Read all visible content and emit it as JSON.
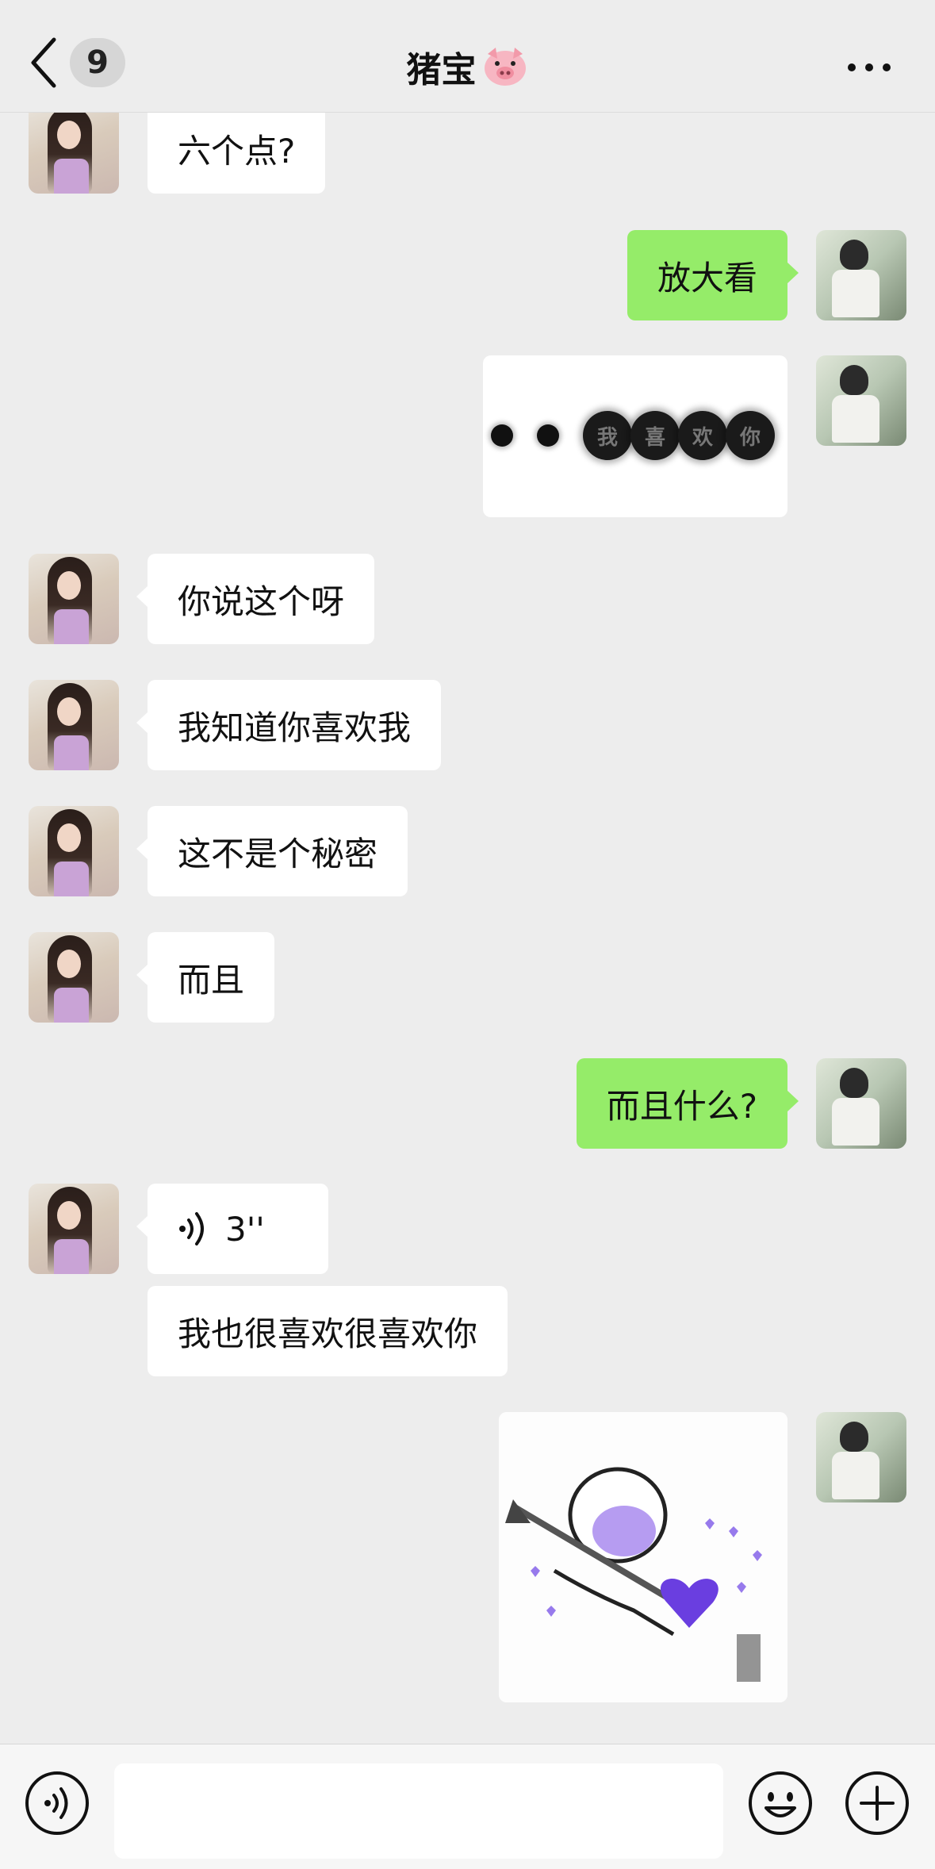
{
  "header": {
    "back_icon": "chevron-left-icon",
    "unread_count": "9",
    "title": "猪宝",
    "title_emoji": "pig-face-icon",
    "more_icon": "more-dots-icon"
  },
  "messages": [
    {
      "side": "left",
      "type": "text",
      "text": "六个点?"
    },
    {
      "side": "right",
      "type": "text",
      "text": "放大看"
    },
    {
      "side": "right",
      "type": "image",
      "dots_text": [
        "我",
        "喜",
        "欢",
        "你"
      ]
    },
    {
      "side": "left",
      "type": "text",
      "text": "你说这个呀"
    },
    {
      "side": "left",
      "type": "text",
      "text": "我知道你喜欢我"
    },
    {
      "side": "left",
      "type": "text",
      "text": "这不是个秘密"
    },
    {
      "side": "left",
      "type": "text",
      "text": "而且"
    },
    {
      "side": "right",
      "type": "text",
      "text": "而且什么?"
    },
    {
      "side": "left",
      "type": "voice",
      "text": "3''"
    },
    {
      "side": "left",
      "type": "text",
      "text": "我也很喜欢很喜欢你"
    },
    {
      "side": "right",
      "type": "sticker",
      "sticker": "heart-arrow-sticker"
    }
  ],
  "input": {
    "placeholder": "",
    "voice_icon": "voice-mode-icon",
    "emoji_icon": "emoji-icon",
    "plus_icon": "plus-icon"
  },
  "colors": {
    "background": "#ededed",
    "sent_bubble": "#95ec69",
    "received_bubble": "#ffffff"
  }
}
